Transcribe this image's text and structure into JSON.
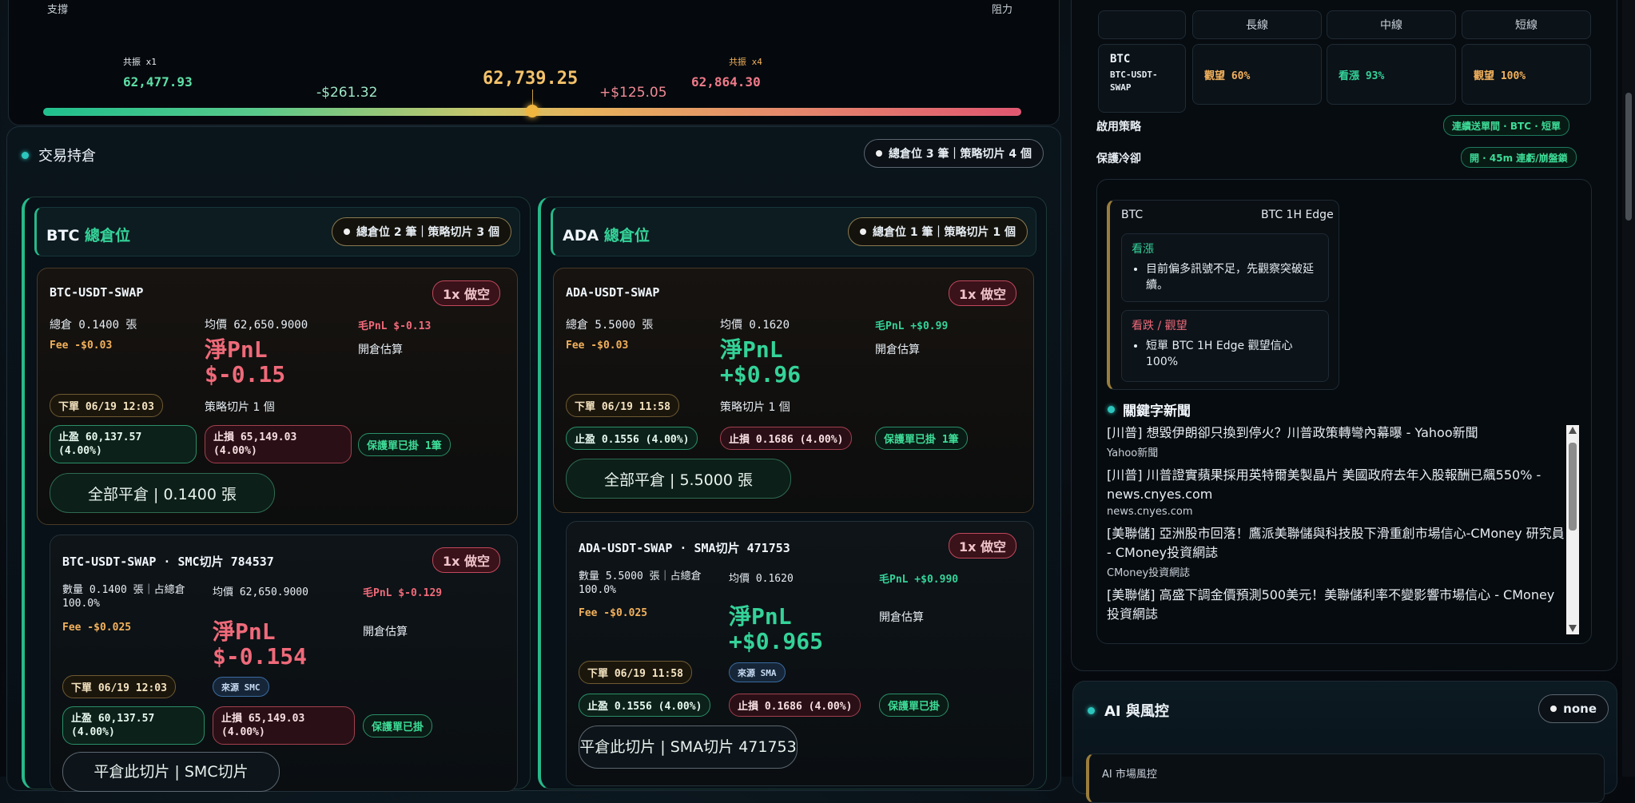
{
  "band": {
    "support_label": "支撐",
    "resist_label": "阻力",
    "left_tag": "共振 x1",
    "left_price": "62,477.93",
    "left_diff": "-$261.32",
    "mid_price": "62,739.25",
    "right_diff": "+$125.05",
    "right_tag": "共振 x4",
    "right_price": "62,864.30"
  },
  "positions": {
    "title": "交易持倉",
    "summary": "總倉位 3 筆｜策略切片 4 個",
    "btc": {
      "sym": "BTC",
      "label": "總倉位",
      "summary": "總倉位 2 筆｜策略切片 3 個",
      "main": {
        "symbol": "BTC-USDT-SWAP",
        "side": "1x 做空",
        "size": "總倉 0.1400 張",
        "avg": "均價 62,650.9000",
        "gross": "毛PnL $-0.13",
        "fee": "Fee -$0.03",
        "net_label": "淨PnL",
        "net_value": "$-0.15",
        "estimate": "開倉估算",
        "order": "下單 06/19 12:03",
        "slices": "策略切片 1 個",
        "tp": "止盈 60,137.57 (4.00%)",
        "sl": "止損 65,149.03 (4.00%)",
        "guard": "保護單已掛 1筆",
        "close": "全部平倉 | 0.1400 張"
      },
      "slice": {
        "symbol": "BTC-USDT-SWAP · SMC切片 784537",
        "side": "1x 做空",
        "size": "數量 0.1400 張｜占總倉 100.0%",
        "avg": "均價 62,650.9000",
        "gross": "毛PnL $-0.129",
        "fee": "Fee -$0.025",
        "net_label": "淨PnL",
        "net_value": "$-0.154",
        "estimate": "開倉估算",
        "order": "下單 06/19 12:03",
        "source": "來源 SMC",
        "tp": "止盈 60,137.57 (4.00%)",
        "sl": "止損 65,149.03 (4.00%)",
        "guard": "保護單已掛",
        "close": "平倉此切片 | SMC切片"
      }
    },
    "ada": {
      "sym": "ADA",
      "label": "總倉位",
      "summary": "總倉位 1 筆｜策略切片 1 個",
      "main": {
        "symbol": "ADA-USDT-SWAP",
        "side": "1x 做空",
        "size": "總倉 5.5000 張",
        "avg": "均價 0.1620",
        "gross": "毛PnL +$0.99",
        "fee": "Fee -$0.03",
        "net_label": "淨PnL",
        "net_value": "+$0.96",
        "estimate": "開倉估算",
        "order": "下單 06/19 11:58",
        "slices": "策略切片 1 個",
        "tp": "止盈 0.1556 (4.00%)",
        "sl": "止損 0.1686 (4.00%)",
        "guard": "保護單已掛 1筆",
        "close": "全部平倉 | 5.5000 張"
      },
      "slice": {
        "symbol": "ADA-USDT-SWAP · SMA切片 471753",
        "side": "1x 做空",
        "size": "數量 5.5000 張｜占總倉 100.0%",
        "avg": "均價 0.1620",
        "gross": "毛PnL +$0.990",
        "fee": "Fee -$0.025",
        "net_label": "淨PnL",
        "net_value": "+$0.965",
        "estimate": "開倉估算",
        "order": "下單 06/19 11:58",
        "source": "來源 SMA",
        "tp": "止盈 0.1556 (4.00%)",
        "sl": "止損 0.1686 (4.00%)",
        "guard": "保護單已掛",
        "close": "平倉此切片 | SMA切片 471753"
      }
    }
  },
  "strategy": {
    "headers": [
      "長線",
      "中線",
      "短線"
    ],
    "row_sym": "BTC",
    "row_pair": "BTC-USDT-SWAP",
    "long": "觀望 60%",
    "mid": "看漲 93%",
    "short": "觀望 100%",
    "enabled_label": "啟用策略",
    "enabled_value": "連續送單間 · BTC · 短單",
    "cooldown_label": "保護冷卻",
    "cooldown_value": "開 · 45m 連虧/崩盤鎖"
  },
  "edge": {
    "sym": "BTC",
    "name": "BTC 1H Edge",
    "bull_title": "看漲",
    "bull_item": "目前偏多訊號不足，先觀察突破延續。",
    "bear_title": "看跌 / 觀望",
    "bear_item": "短單 BTC 1H Edge 觀望信心 100%"
  },
  "news": {
    "title": "關鍵字新聞",
    "items": [
      {
        "headline": "[川普] 想毀伊朗卻只換到停火？川普政策轉彎內幕曝 - Yahoo新聞",
        "source": "Yahoo新聞"
      },
      {
        "headline": "[川普] 川普證實蘋果採用英特爾美製晶片 美國政府去年入股報酬已飆550% - news.cnyes.com",
        "source": "news.cnyes.com"
      },
      {
        "headline": "[美聯儲] 亞洲股市回落！鷹派美聯儲與科技股下滑重創市場信心-CMoney 研究員 - CMoney投資網誌",
        "source": "CMoney投資網誌"
      },
      {
        "headline": "[美聯儲] 高盛下調金價預測500美元！美聯儲利率不變影響市場信心 - CMoney 投資網誌",
        "source": ""
      }
    ]
  },
  "ai": {
    "title": "AI 與風控",
    "badge": "none",
    "sub": "AI 市場風控"
  }
}
